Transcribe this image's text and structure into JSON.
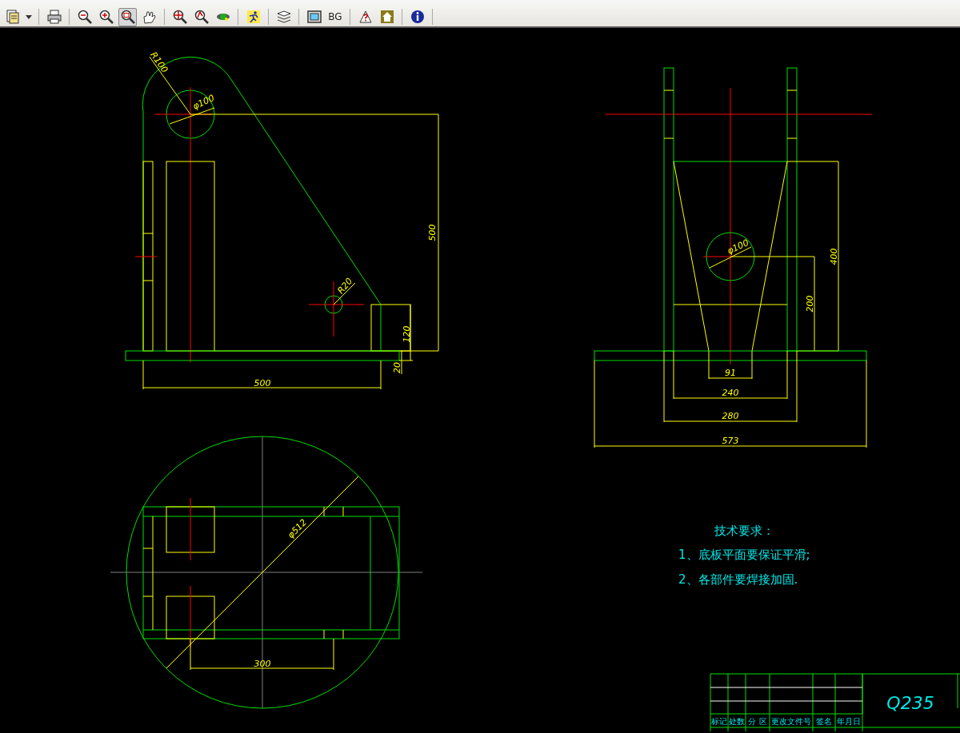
{
  "toolbar": {
    "buttons": [
      {
        "kind": "icon",
        "selected": false
      },
      {
        "kind": "dropdown",
        "selected": false
      },
      {
        "kind": "separator"
      },
      {
        "kind": "icon",
        "selected": false
      },
      {
        "kind": "separator"
      },
      {
        "kind": "icon",
        "selected": false
      },
      {
        "kind": "icon",
        "selected": false
      },
      {
        "kind": "icon",
        "selected": true
      },
      {
        "kind": "icon",
        "selected": false
      },
      {
        "kind": "separator"
      },
      {
        "kind": "icon",
        "selected": false
      },
      {
        "kind": "icon",
        "selected": false
      },
      {
        "kind": "icon",
        "selected": false
      },
      {
        "kind": "separator"
      },
      {
        "kind": "icon",
        "selected": false
      },
      {
        "kind": "separator"
      },
      {
        "kind": "icon",
        "selected": false
      },
      {
        "kind": "separator"
      },
      {
        "kind": "icon",
        "selected": false
      },
      {
        "kind": "text",
        "label": "BG",
        "selected": false
      },
      {
        "kind": "separator"
      },
      {
        "kind": "icon",
        "selected": false
      },
      {
        "kind": "icon",
        "selected": false
      },
      {
        "kind": "separator"
      },
      {
        "kind": "icon",
        "selected": false
      },
      {
        "kind": "separator"
      }
    ]
  },
  "drawing": {
    "side_view": {
      "labels": [
        "R100",
        "φ100",
        "500",
        "R20",
        "120",
        "20",
        "500"
      ]
    },
    "front_view": {
      "labels": [
        "φ100",
        "400",
        "200",
        "91",
        "240",
        "280",
        "573"
      ]
    },
    "top_view": {
      "labels": [
        "φ512",
        "300"
      ]
    },
    "notes": {
      "title": "技术要求：",
      "items": [
        "1、底板平面要保证平滑;",
        "2、各部件要焊接加固."
      ]
    },
    "title_block": {
      "headers": [
        "标记",
        "处数",
        "分 区",
        "更改文件号",
        "签名",
        "年月日"
      ],
      "material": "Q235"
    }
  }
}
